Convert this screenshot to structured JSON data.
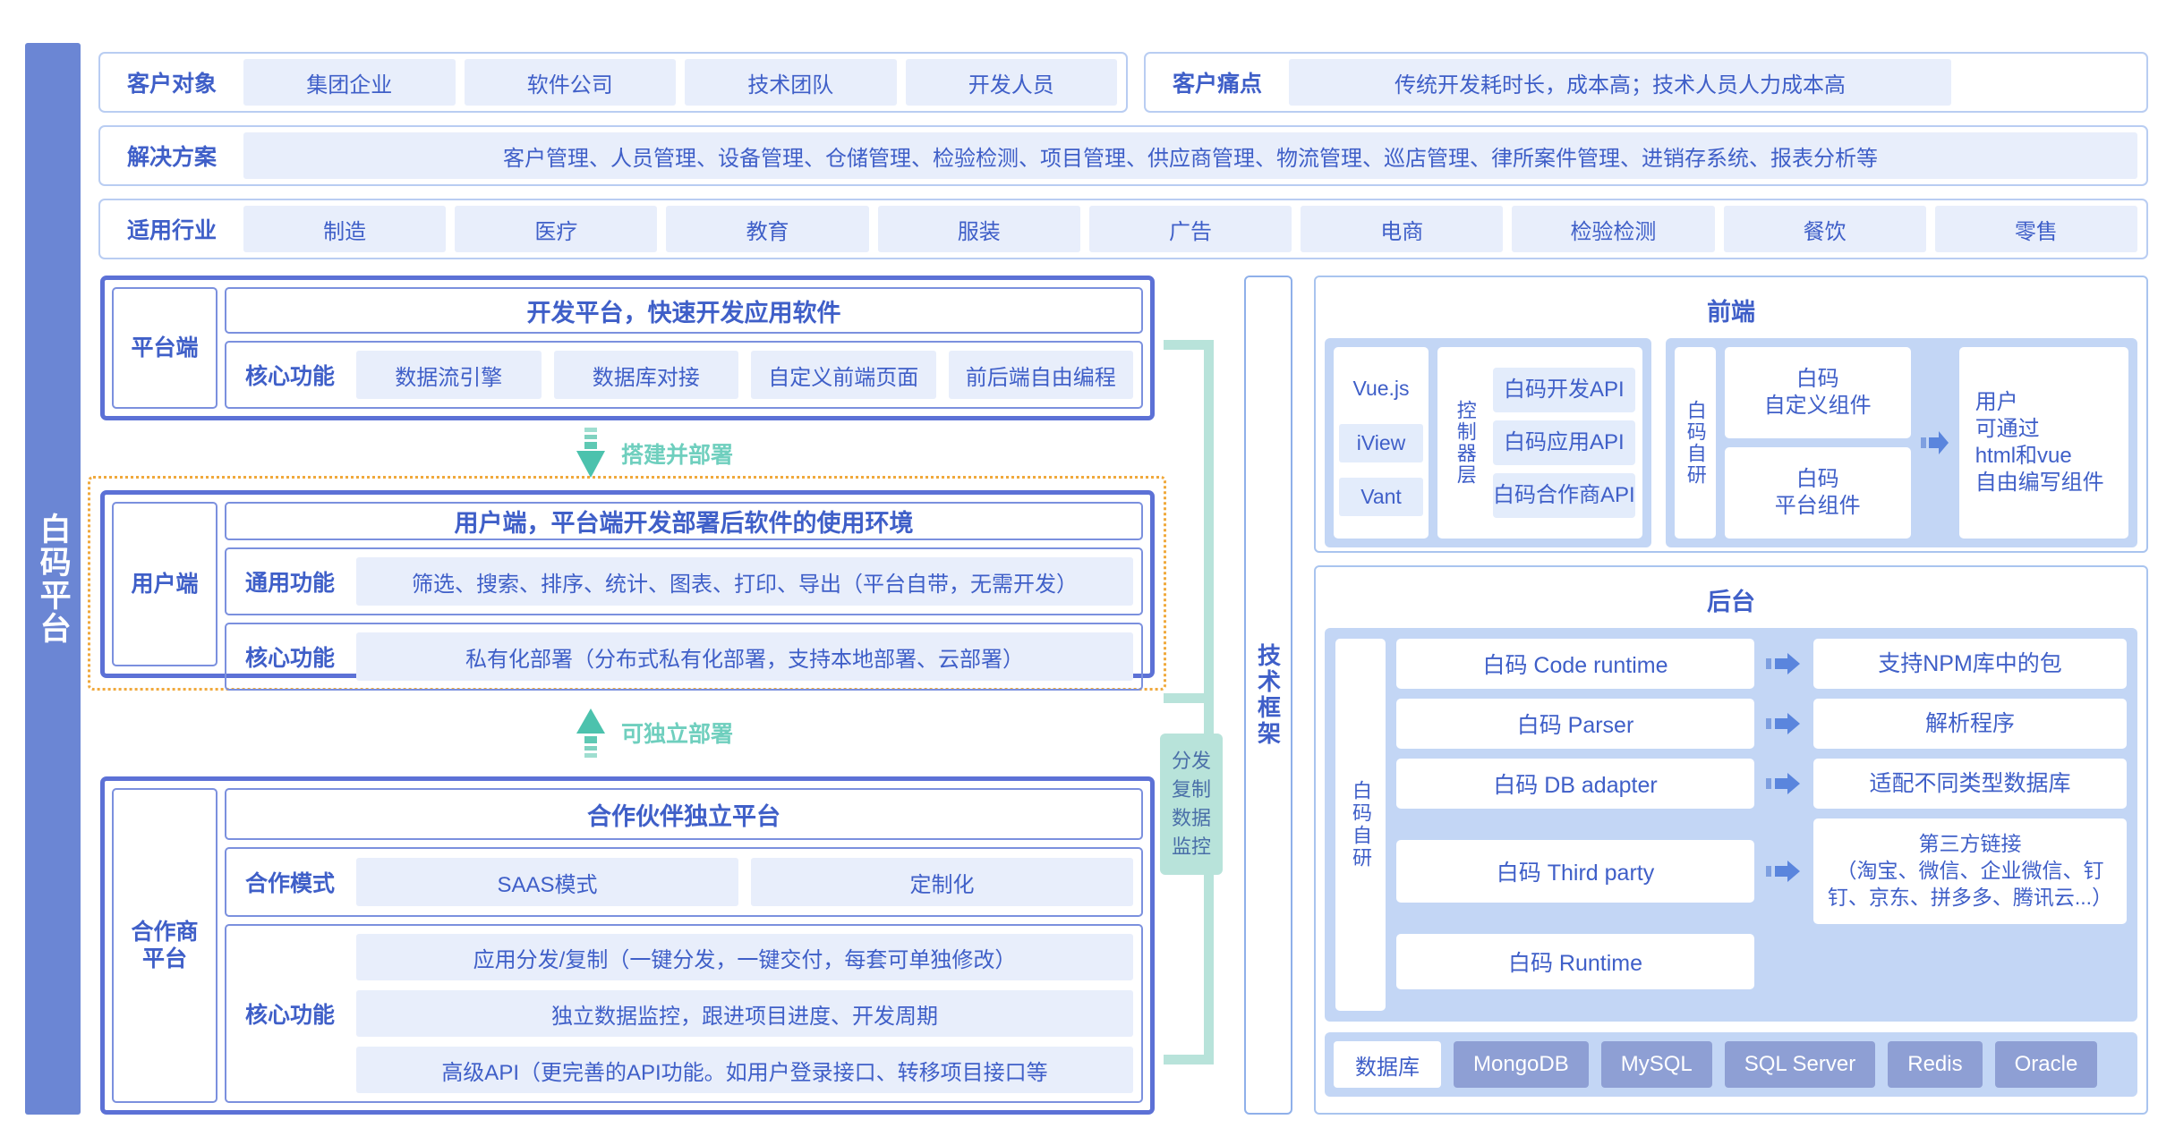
{
  "brand": {
    "vertical_title": "白码平台",
    "accent_blue": "#5c71d6",
    "panel_blue": "#6b86d4",
    "chip_bg": "#e8eefb",
    "teal": "#6fcfbe",
    "dashed_orange": "#f0a93c"
  },
  "header_rows": {
    "customers": {
      "label": "客户对象",
      "items": [
        "集团企业",
        "软件公司",
        "技术团队",
        "开发人员"
      ]
    },
    "painpoints": {
      "label": "客户痛点",
      "items": [
        "传统开发耗时长，成本高；技术人员人力成本高"
      ]
    },
    "solutions": {
      "label": "解决方案",
      "items": [
        "客户管理、人员管理、设备管理、仓储管理、检验检测、项目管理、供应商管理、物流管理、巡店管理、律所案件管理、进销存系统、报表分析等"
      ]
    },
    "industries": {
      "label": "适用行业",
      "items": [
        "制造",
        "医疗",
        "教育",
        "服装",
        "广告",
        "电商",
        "检验检测",
        "餐饮",
        "零售"
      ]
    }
  },
  "platform_panel": {
    "side_label": "平台端",
    "title": "开发平台，快速开发应用软件",
    "sub_label": "核心功能",
    "features": [
      "数据流引擎",
      "数据库对接",
      "自定义前端页面",
      "前后端自由编程"
    ]
  },
  "deploy_arrow_down": {
    "label": "搭建并部署",
    "icon": "arrow-down-icon"
  },
  "user_panel": {
    "side_label": "用户端",
    "title": "用户端，平台端开发部署后软件的使用环境",
    "rows": [
      {
        "label": "通用功能",
        "value": "筛选、搜索、排序、统计、图表、打印、导出（平台自带，无需开发）"
      },
      {
        "label": "核心功能",
        "value": "私有化部署（分布式私有化部署，支持本地部署、云部署）"
      }
    ]
  },
  "deploy_arrow_up": {
    "label": "可独立部署",
    "icon": "arrow-up-icon"
  },
  "partner_panel": {
    "side_label": "合作商\n平台",
    "title": "合作伙伴独立平台",
    "mode_label": "合作模式",
    "modes": [
      "SAAS模式",
      "定制化"
    ],
    "core_label": "核心功能",
    "core_items": [
      "应用分发/复制（一键分发，一键交付，每套可单独修改）",
      "独立数据监控，跟进项目进度、开发周期",
      "高级API（更完善的API功能。如用户登录接口、转移项目接口等"
    ]
  },
  "distribution": {
    "lines": "分发\n复制\n数据\n监控"
  },
  "tech_framework": {
    "label": "技术框架"
  },
  "frontend": {
    "title": "前端",
    "libs": [
      "Vue.js",
      "iView",
      "Vant"
    ],
    "controller_label": "控制器层",
    "apis": [
      "白码开发API",
      "白码应用API",
      "白码合作商API"
    ],
    "selfdev_label": "白码自研",
    "components": [
      "白码\n自定义组件",
      "白码\n平台组件"
    ],
    "result": "用户\n可通过\nhtml和vue\n自由编写组件"
  },
  "backend": {
    "title": "后台",
    "selfdev_label": "白码自研",
    "rows": [
      {
        "left": "白码 Code runtime",
        "right": "支持NPM库中的包",
        "arrow": true
      },
      {
        "left": "白码 Parser",
        "right": "解析程序",
        "arrow": true
      },
      {
        "left": "白码 DB adapter",
        "right": "适配不同类型数据库",
        "arrow": true
      },
      {
        "left": "白码 Third party",
        "right": "第三方链接\n（淘宝、微信、企业微信、钉钉、京东、拼多多、腾讯云...）",
        "arrow": true
      },
      {
        "left": "白码 Runtime",
        "right": "",
        "arrow": false
      }
    ],
    "database": {
      "label": "数据库",
      "items": [
        "MongoDB",
        "MySQL",
        "SQL Server",
        "Redis",
        "Oracle"
      ]
    }
  }
}
